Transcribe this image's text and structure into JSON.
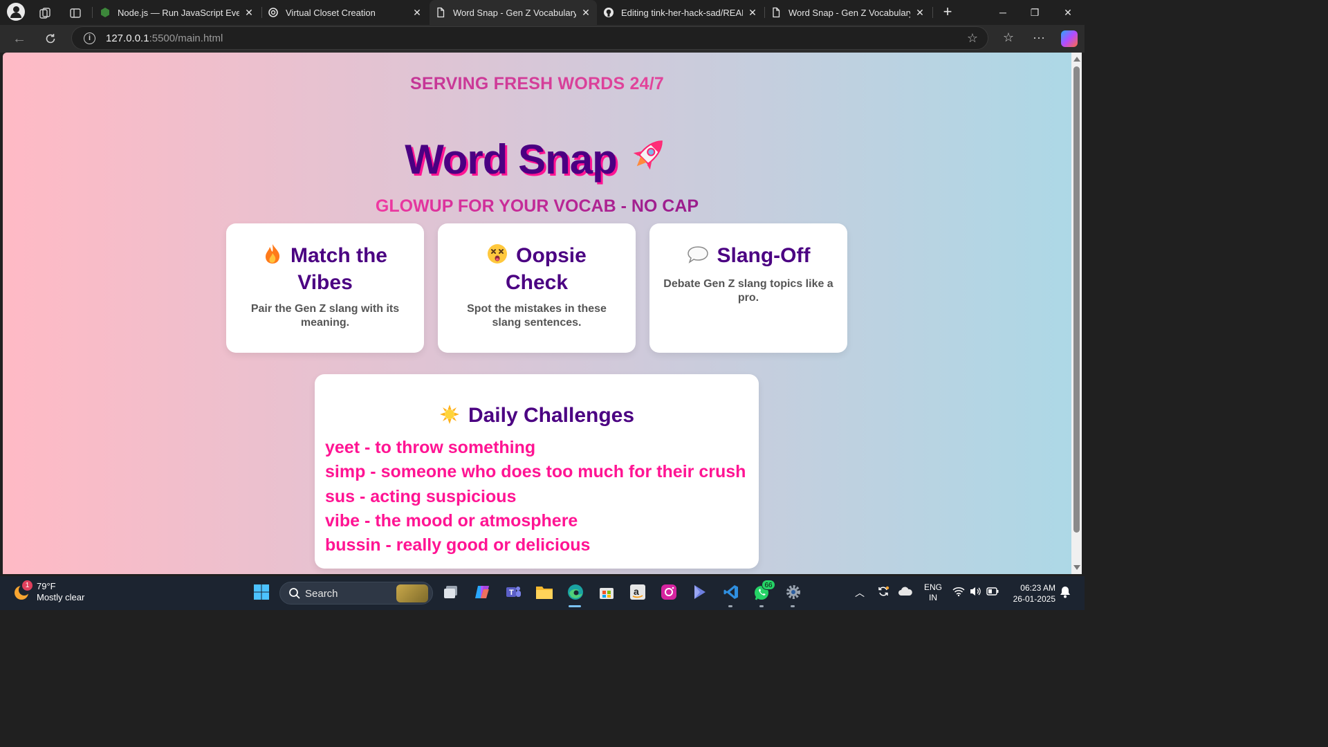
{
  "browser": {
    "tabs": [
      {
        "title": "Node.js — Run JavaScript Everyw",
        "favicon": "nodejs-icon",
        "active": false
      },
      {
        "title": "Virtual Closet Creation",
        "favicon": "openai-icon",
        "active": false
      },
      {
        "title": "Word Snap - Gen Z Vocabulary",
        "favicon": "page-icon",
        "active": true
      },
      {
        "title": "Editing tink-her-hack-sad/READM",
        "favicon": "github-icon",
        "active": false
      },
      {
        "title": "Word Snap - Gen Z Vocabulary",
        "favicon": "page-icon",
        "active": false
      }
    ],
    "url_host": "127.0.0.1",
    "url_rest": ":5500/main.html"
  },
  "page": {
    "tagline": "SERVING FRESH WORDS 24/7",
    "title": "Word Snap",
    "title_emoji": "rocket-icon",
    "subtitle": "GLOWUP FOR YOUR VOCAB - NO CAP",
    "cards": [
      {
        "icon": "fire-icon",
        "title": "Match the Vibes",
        "desc": "Pair the Gen Z slang with its meaning."
      },
      {
        "icon": "dizzy-face-icon",
        "title": "Oopsie Check",
        "desc": "Spot the mistakes in these slang sentences."
      },
      {
        "icon": "speech-bubble-icon",
        "title": "Slang-Off",
        "desc": "Debate Gen Z slang topics like a pro."
      }
    ],
    "daily": {
      "icon": "sun-icon",
      "title": "Daily Challenges",
      "items": [
        "yeet - to throw something",
        "simp - someone who does too much for their crush",
        "sus - acting suspicious",
        "vibe - the mood or atmosphere",
        "bussin - really good or delicious"
      ]
    },
    "colors": {
      "title": "#4b0082",
      "title_shadow": "#ff1493",
      "list": "#ff1493",
      "bg_left": "#ffbac5",
      "bg_right": "#add8e6"
    }
  },
  "taskbar": {
    "weather_temp": "79°F",
    "weather_desc": "Mostly clear",
    "weather_badge": "1",
    "search_label": "Search",
    "whatsapp_badge": "66",
    "lang_top": "ENG",
    "lang_bottom": "IN",
    "time": "06:23 AM",
    "date": "26-01-2025"
  }
}
